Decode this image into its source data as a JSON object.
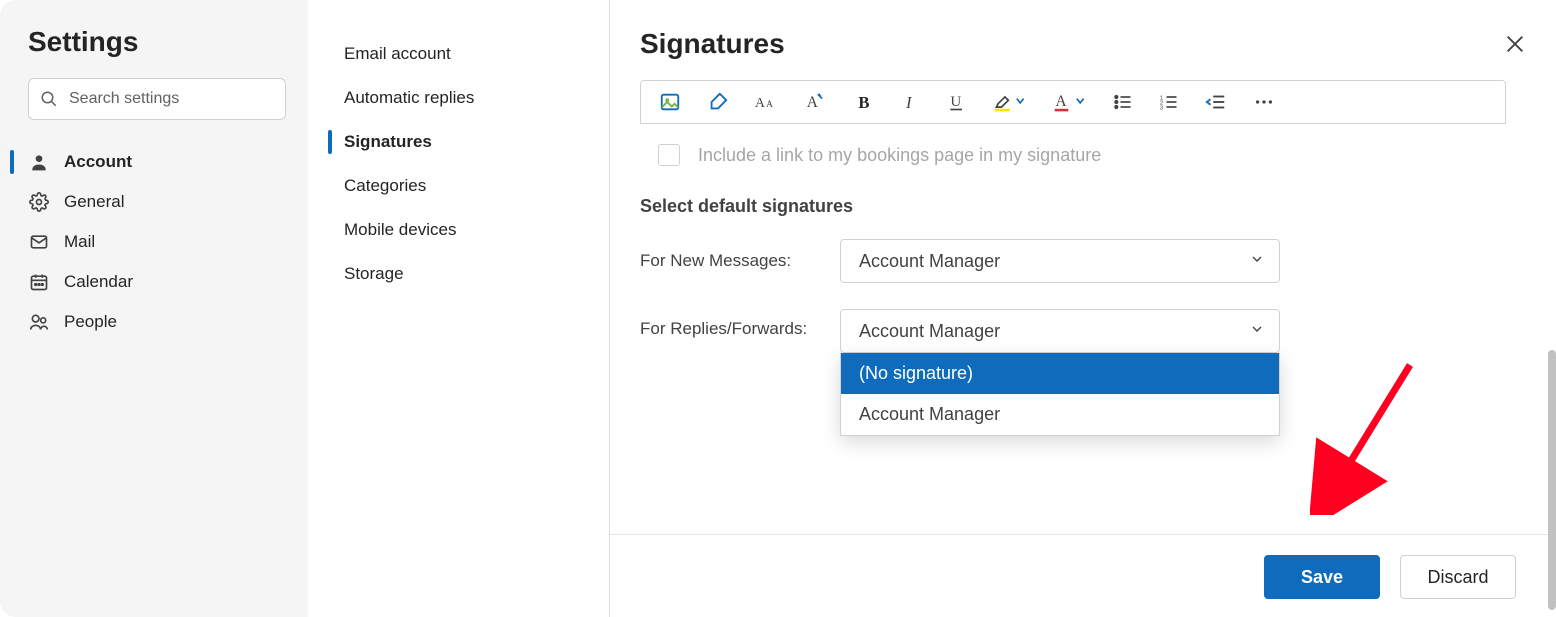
{
  "title": "Settings",
  "search_placeholder": "Search settings",
  "nav": [
    {
      "label": "Account",
      "icon": "person"
    },
    {
      "label": "General",
      "icon": "gear"
    },
    {
      "label": "Mail",
      "icon": "mail"
    },
    {
      "label": "Calendar",
      "icon": "calendar"
    },
    {
      "label": "People",
      "icon": "people"
    }
  ],
  "nav_active_index": 0,
  "subnav": [
    {
      "label": "Email account"
    },
    {
      "label": "Automatic replies"
    },
    {
      "label": "Signatures"
    },
    {
      "label": "Categories"
    },
    {
      "label": "Mobile devices"
    },
    {
      "label": "Storage"
    }
  ],
  "subnav_active_index": 2,
  "main": {
    "title": "Signatures",
    "checkbox_label": "Include a link to my bookings page in my signature",
    "checkbox_checked": false,
    "checkbox_disabled": true,
    "section_label": "Select default signatures",
    "new_label": "For New Messages:",
    "reply_label": "For Replies/Forwards:",
    "new_value": "Account Manager",
    "reply_value": "Account Manager",
    "reply_options": [
      "(No signature)",
      "Account Manager"
    ],
    "reply_highlight_index": 0
  },
  "buttons": {
    "save": "Save",
    "discard": "Discard"
  },
  "colors": {
    "accent": "#0f6cbd",
    "arrow": "#ff0020"
  }
}
